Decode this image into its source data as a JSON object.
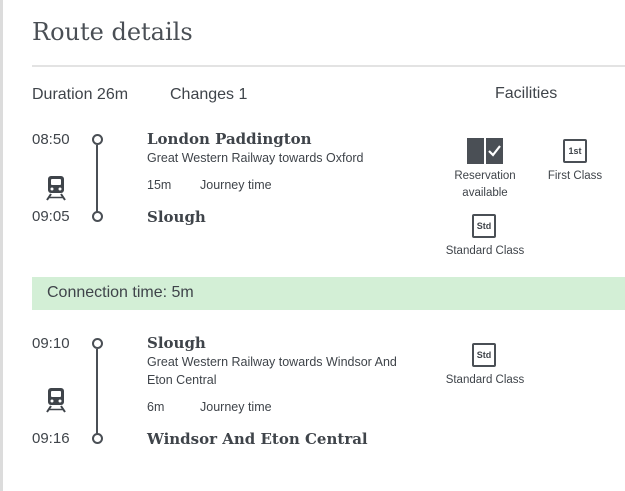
{
  "page": {
    "title": "Route details"
  },
  "summary": {
    "duration": "Duration 26m",
    "changes": "Changes 1",
    "facilities_header": "Facilities"
  },
  "legs": [
    {
      "depart_time": "08:50",
      "arrive_time": "09:05",
      "from": "London Paddington",
      "to": "Slough",
      "operator": "Great Western Railway towards Oxford",
      "duration": "15m",
      "duration_label": "Journey time",
      "facilities": [
        {
          "icon": "reservation-icon",
          "label": "Reservation available"
        },
        {
          "icon": "first-class-icon",
          "badge": "1st",
          "label": "First Class"
        },
        {
          "icon": "standard-class-icon",
          "badge": "Std",
          "label": "Standard Class"
        }
      ]
    },
    {
      "depart_time": "09:10",
      "arrive_time": "09:16",
      "from": "Slough",
      "to": "Windsor And Eton Central",
      "operator": "Great Western Railway towards Windsor And Eton Central",
      "duration": "6m",
      "duration_label": "Journey time",
      "facilities": [
        {
          "icon": "standard-class-icon",
          "badge": "Std",
          "label": "Standard Class"
        }
      ]
    }
  ],
  "connection": {
    "text": "Connection time: 5m"
  },
  "colors": {
    "connection_bg": "#d3efd6",
    "text": "#3f444a",
    "divider": "#e3e3e3"
  }
}
